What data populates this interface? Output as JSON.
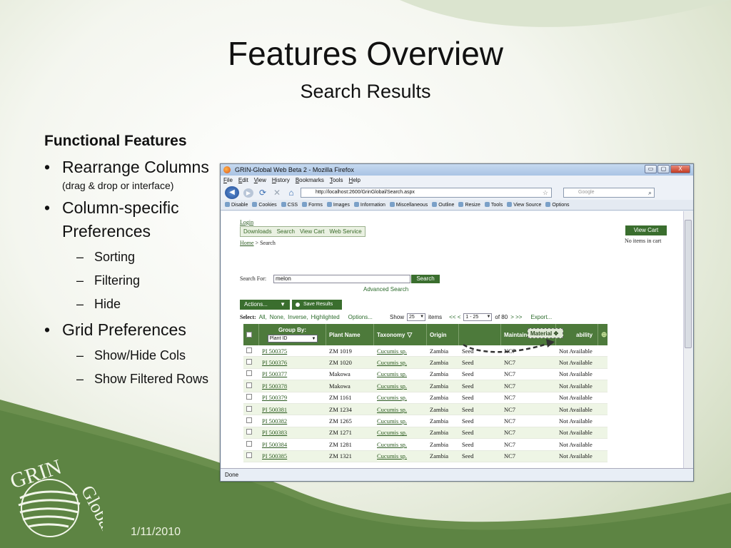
{
  "slide": {
    "title": "Features Overview",
    "subtitle": "Search Results",
    "features_heading": "Functional Features",
    "bullets": [
      {
        "label": "Rearrange Columns",
        "note": "(drag & drop or interface)"
      },
      {
        "label": "Column-specific Preferences",
        "subs": [
          "Sorting",
          "Filtering",
          "Hide"
        ]
      },
      {
        "label": "Grid Preferences",
        "subs": [
          "Show/Hide Cols",
          "Show Filtered Rows"
        ]
      }
    ],
    "dash": "–",
    "date": "1/11/2010"
  },
  "browser": {
    "window_title": "GRIN-Global Web Beta 2 - Mozilla Firefox",
    "window_buttons": [
      "▭",
      "▢",
      "X"
    ],
    "menu": [
      "File",
      "Edit",
      "View",
      "History",
      "Bookmarks",
      "Tools",
      "Help"
    ],
    "url": "http://localhost:2600/GrinGlobal/Search.aspx",
    "search_engine_placeholder": "Google",
    "toolbar": [
      "Disable",
      "Cookies",
      "CSS",
      "Forms",
      "Images",
      "Information",
      "Miscellaneous",
      "Outline",
      "Resize",
      "Tools",
      "View Source",
      "Options"
    ],
    "status": "Done"
  },
  "page": {
    "login": "Login",
    "nav_tabs": [
      "Downloads",
      "Search",
      "View Cart",
      "Web Service"
    ],
    "breadcrumb_home": "Home",
    "breadcrumb_rest": " > Search",
    "view_cart": "View Cart",
    "cart_status": "No items in cart",
    "search_label": "Search For:",
    "search_value": "melon",
    "search_button": "Search",
    "advanced_search": "Advanced Search",
    "actions_button": "Actions...",
    "save_results": "Save Results",
    "select_label": "Select:",
    "select_links": [
      "All,",
      "None,",
      "Inverse,",
      "Highlighted"
    ],
    "options_link": "Options...",
    "show_label": "Show",
    "page_size": "25",
    "items_label": "items",
    "prev_links": "<< <",
    "page_range": "1 - 25",
    "of_total": "of 80",
    "next_links": "> >>",
    "export_link": "Export..."
  },
  "grid": {
    "group_by_label": "Group By:",
    "group_by_value": "Plant ID",
    "columns": [
      "Plant Name",
      "Taxonomy",
      "Origin",
      "",
      "Maintained B",
      "ability"
    ],
    "drag_column": "Material",
    "rows": [
      {
        "id": "PI 500375",
        "name": "ZM 1019",
        "tax": "Cucumis sp.",
        "origin": "Zambia",
        "type": "Seed",
        "maint": "NC7",
        "avail": "Not Available"
      },
      {
        "id": "PI 500376",
        "name": "ZM 1020",
        "tax": "Cucumis sp.",
        "origin": "Zambia",
        "type": "Seed",
        "maint": "NC7",
        "avail": "Not Available"
      },
      {
        "id": "PI 500377",
        "name": "Makowa",
        "tax": "Cucumis sp.",
        "origin": "Zambia",
        "type": "Seed",
        "maint": "NC7",
        "avail": "Not Available"
      },
      {
        "id": "PI 500378",
        "name": "Makowa",
        "tax": "Cucumis sp.",
        "origin": "Zambia",
        "type": "Seed",
        "maint": "NC7",
        "avail": "Not Available"
      },
      {
        "id": "PI 500379",
        "name": "ZM 1161",
        "tax": "Cucumis sp.",
        "origin": "Zambia",
        "type": "Seed",
        "maint": "NC7",
        "avail": "Not Available"
      },
      {
        "id": "PI 500381",
        "name": "ZM 1234",
        "tax": "Cucumis sp.",
        "origin": "Zambia",
        "type": "Seed",
        "maint": "NC7",
        "avail": "Not Available"
      },
      {
        "id": "PI 500382",
        "name": "ZM 1265",
        "tax": "Cucumis sp.",
        "origin": "Zambia",
        "type": "Seed",
        "maint": "NC7",
        "avail": "Not Available"
      },
      {
        "id": "PI 500383",
        "name": "ZM 1271",
        "tax": "Cucumis sp.",
        "origin": "Zambia",
        "type": "Seed",
        "maint": "NC7",
        "avail": "Not Available"
      },
      {
        "id": "PI 500384",
        "name": "ZM 1281",
        "tax": "Cucumis sp.",
        "origin": "Zambia",
        "type": "Seed",
        "maint": "NC7",
        "avail": "Not Available"
      },
      {
        "id": "PI 500385",
        "name": "ZM 1321",
        "tax": "Cucumis sp.",
        "origin": "Zambia",
        "type": "Seed",
        "maint": "NC7",
        "avail": "Not Available"
      }
    ]
  },
  "colors": {
    "accent_green": "#3a6e2e",
    "header_green": "#4d7a3b",
    "link_green": "#2a5a1e"
  }
}
